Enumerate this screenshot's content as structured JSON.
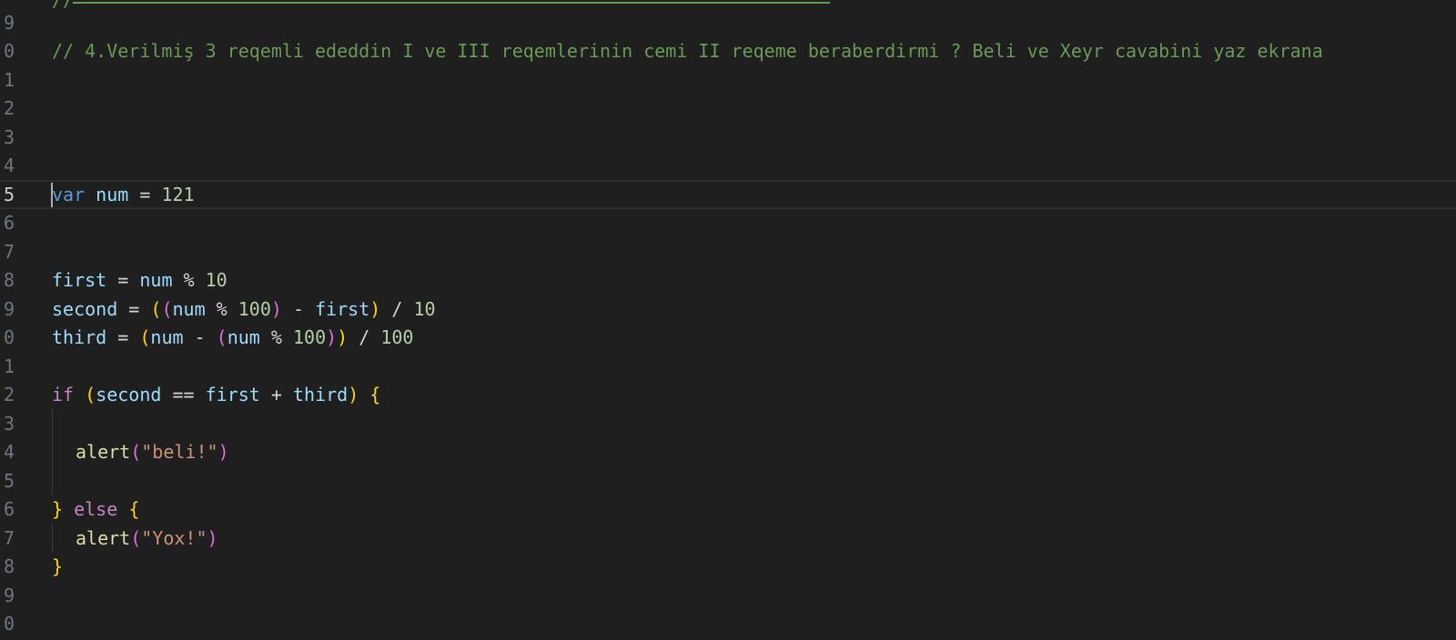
{
  "editor": {
    "top_comment_prefix": "//",
    "line_numbers": [
      "9",
      "0",
      "1",
      "2",
      "3",
      "4",
      "5",
      "6",
      "7",
      "8",
      "9",
      "0",
      "1",
      "2",
      "3",
      "4",
      "5",
      "6",
      "7",
      "8",
      "9",
      "0"
    ],
    "comment_line": "// 4.Verilmiş 3 reqemli ededdin I ve III reqemlerinin cemi II reqeme beraberdirmi ? Beli ve Xeyr cavabini yaz ekrana",
    "tokens": {
      "var": "var",
      "num": "num",
      "eq": "=",
      "n121": "121",
      "first": "first",
      "second": "second",
      "third": "third",
      "mod": "%",
      "n10": "10",
      "n100": "100",
      "minus": "-",
      "div": "/",
      "lparen": "(",
      "rparen": ")",
      "if": "if",
      "else": "else",
      "eqeq": "==",
      "plus": "+",
      "lbrace": "{",
      "rbrace": "}",
      "alert": "alert",
      "str_beli": "\"beli!\"",
      "str_yox": "\"Yox!\""
    }
  },
  "colors": {
    "background": "#1f1f1f",
    "comment": "#6a9955",
    "keyword": "#569cd6",
    "control": "#c586c0",
    "variable": "#9cdcfe",
    "number": "#b5cea8",
    "function": "#dcdcaa",
    "string": "#ce9178",
    "bracket_1": "#ffd700",
    "bracket_2": "#da70d6"
  }
}
